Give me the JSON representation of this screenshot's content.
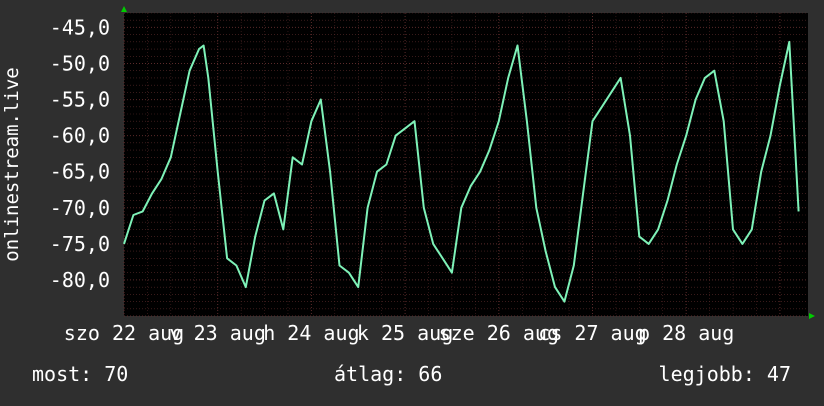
{
  "colors": {
    "background": "#2f2f2f",
    "plot_background": "#000000",
    "grid": "#5a2a2a",
    "line": "#7ef2b8",
    "text": "#ffffff",
    "arrow": "#00cc00"
  },
  "chart_data": {
    "type": "line",
    "ylabel": "onlinestream.live",
    "ylim": [
      -85,
      -43
    ],
    "yticks": [
      -80,
      -75,
      -70,
      -65,
      -60,
      -55,
      -50,
      -45
    ],
    "ytick_labels": [
      "-80,0",
      "-75,0",
      "-70,0",
      "-65,0",
      "-60,0",
      "-55,0",
      "-50,0",
      "-45,0"
    ],
    "grid": true,
    "xlim": [
      0,
      7.3
    ],
    "xtick_positions": [
      0,
      1,
      2,
      3,
      4,
      5,
      6
    ],
    "xtick_labels": [
      "szo 22 aug",
      "v 23 aug",
      "h 24 aug",
      "k 25 aug",
      "sze 26 aug",
      "cs 27 aug",
      "p 28 aug"
    ],
    "series": [
      {
        "x": [
          0.0,
          0.1,
          0.2,
          0.3,
          0.4,
          0.5,
          0.6,
          0.7,
          0.8,
          0.85,
          0.9,
          1.0,
          1.1,
          1.2,
          1.3,
          1.4,
          1.5,
          1.6,
          1.7,
          1.8,
          1.9,
          2.0,
          2.1,
          2.2,
          2.3,
          2.4,
          2.5,
          2.6,
          2.7,
          2.8,
          2.9,
          3.0,
          3.1,
          3.2,
          3.3,
          3.4,
          3.5,
          3.6,
          3.7,
          3.8,
          3.9,
          4.0,
          4.1,
          4.2,
          4.3,
          4.4,
          4.5,
          4.6,
          4.7,
          4.8,
          4.9,
          5.0,
          5.1,
          5.2,
          5.3,
          5.4,
          5.5,
          5.6,
          5.7,
          5.8,
          5.9,
          6.0,
          6.1,
          6.2,
          6.3,
          6.4,
          6.5,
          6.6,
          6.7,
          6.8,
          6.9,
          7.0,
          7.1,
          7.2
        ],
        "y": [
          -75,
          -71,
          -70.5,
          -68,
          -66,
          -63,
          -57,
          -51,
          -48,
          -47.5,
          -52,
          -65,
          -77,
          -78,
          -81,
          -74,
          -69,
          -68,
          -73,
          -63,
          -64,
          -58,
          -55,
          -65,
          -78,
          -79,
          -81,
          -70,
          -65,
          -64,
          -60,
          -59,
          -58,
          -70,
          -75,
          -77,
          -79,
          -70,
          -67,
          -65,
          -62,
          -58,
          -52,
          -47.5,
          -58,
          -70,
          -76,
          -81,
          -83,
          -78,
          -68,
          -58,
          -56,
          -54,
          -52,
          -60,
          -74,
          -75,
          -73,
          -69,
          -64,
          -60,
          -55,
          -52,
          -51,
          -58,
          -73,
          -75,
          -73,
          -65,
          -60,
          -53,
          -47,
          -70.5
        ]
      }
    ],
    "legend": {
      "most": "most: 70",
      "atlag": "átlag: 66",
      "legjobb": "legjobb: 47"
    }
  }
}
